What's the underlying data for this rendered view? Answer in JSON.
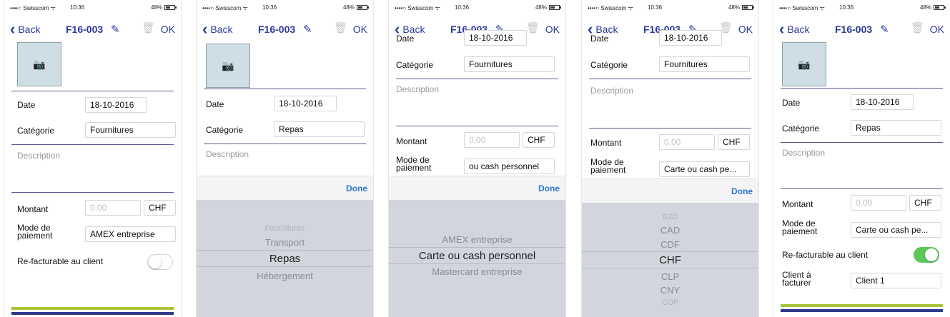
{
  "status": {
    "carrier": "••••○ Swisscom ᯤ",
    "time": "10:36",
    "battery": "48%"
  },
  "nav": {
    "back": "Back",
    "title": "F16-003",
    "ok": "OK"
  },
  "labels": {
    "date": "Date",
    "categorie": "Catégorie",
    "description": "Description",
    "montant": "Montant",
    "mode_line1": "Mode de",
    "mode_line2": "paiement",
    "refacturable": "Re-facturable au client",
    "client_line1": "Client à",
    "client_line2": "facturer",
    "done": "Done"
  },
  "screens": [
    {
      "date": "18-10-2016",
      "categorie": "Fournitures",
      "montant_placeholder": "0.00",
      "currency": "CHF",
      "mode": "AMEX entreprise",
      "refacturable_on": false
    },
    {
      "date": "18-10-2016",
      "categorie": "Repas",
      "picker": [
        "Fournitures",
        "Transport",
        "Repas",
        "Hébergement"
      ]
    },
    {
      "date_partial": "18-10-2016",
      "categorie": "Fournitures",
      "montant_placeholder": "0.00",
      "currency": "CHF",
      "mode": "ou cash personnel",
      "picker": [
        "AMEX entreprise",
        "Carte ou cash personnel",
        "Mastercard entreprise"
      ]
    },
    {
      "date_partial": "18-10-2016",
      "categorie": "Fournitures",
      "montant_placeholder": "0.00",
      "currency": "CHF",
      "mode": "Carte ou cash pe...",
      "picker": [
        "BZD",
        "CAD",
        "CDF",
        "CHF",
        "CLP",
        "CNY",
        "COP"
      ]
    },
    {
      "date": "18-10-2016",
      "categorie": "Repas",
      "montant_placeholder": "0.00",
      "currency": "CHF",
      "mode": "Carte ou cash pe...",
      "refacturable_on": true,
      "client": "Client 1"
    }
  ],
  "colors": {
    "accent": "#2a3a9b",
    "green_bar": "#a8c43a",
    "navy_bar": "#2e3a8c",
    "toggle_on": "#5cc85a",
    "done": "#2f74d6"
  }
}
